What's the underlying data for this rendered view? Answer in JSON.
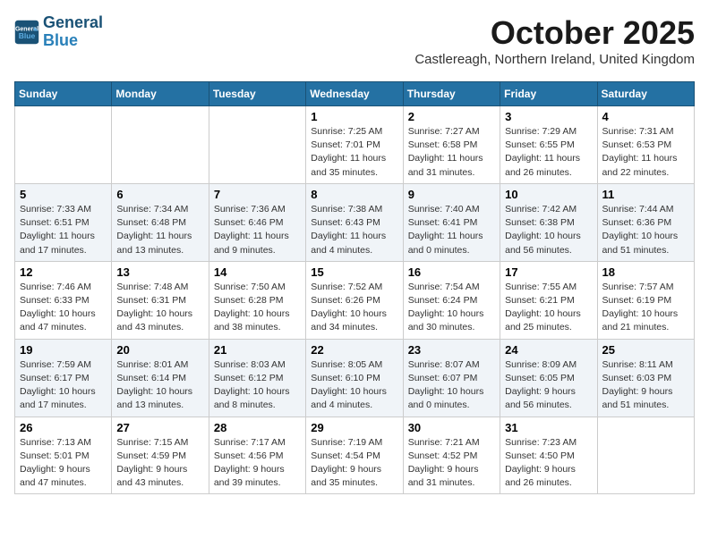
{
  "header": {
    "logo_line1": "General",
    "logo_line2": "Blue",
    "month_title": "October 2025",
    "subtitle": "Castlereagh, Northern Ireland, United Kingdom"
  },
  "days_of_week": [
    "Sunday",
    "Monday",
    "Tuesday",
    "Wednesday",
    "Thursday",
    "Friday",
    "Saturday"
  ],
  "weeks": [
    [
      {
        "day": "",
        "info": ""
      },
      {
        "day": "",
        "info": ""
      },
      {
        "day": "",
        "info": ""
      },
      {
        "day": "1",
        "info": "Sunrise: 7:25 AM\nSunset: 7:01 PM\nDaylight: 11 hours\nand 35 minutes."
      },
      {
        "day": "2",
        "info": "Sunrise: 7:27 AM\nSunset: 6:58 PM\nDaylight: 11 hours\nand 31 minutes."
      },
      {
        "day": "3",
        "info": "Sunrise: 7:29 AM\nSunset: 6:55 PM\nDaylight: 11 hours\nand 26 minutes."
      },
      {
        "day": "4",
        "info": "Sunrise: 7:31 AM\nSunset: 6:53 PM\nDaylight: 11 hours\nand 22 minutes."
      }
    ],
    [
      {
        "day": "5",
        "info": "Sunrise: 7:33 AM\nSunset: 6:51 PM\nDaylight: 11 hours\nand 17 minutes."
      },
      {
        "day": "6",
        "info": "Sunrise: 7:34 AM\nSunset: 6:48 PM\nDaylight: 11 hours\nand 13 minutes."
      },
      {
        "day": "7",
        "info": "Sunrise: 7:36 AM\nSunset: 6:46 PM\nDaylight: 11 hours\nand 9 minutes."
      },
      {
        "day": "8",
        "info": "Sunrise: 7:38 AM\nSunset: 6:43 PM\nDaylight: 11 hours\nand 4 minutes."
      },
      {
        "day": "9",
        "info": "Sunrise: 7:40 AM\nSunset: 6:41 PM\nDaylight: 11 hours\nand 0 minutes."
      },
      {
        "day": "10",
        "info": "Sunrise: 7:42 AM\nSunset: 6:38 PM\nDaylight: 10 hours\nand 56 minutes."
      },
      {
        "day": "11",
        "info": "Sunrise: 7:44 AM\nSunset: 6:36 PM\nDaylight: 10 hours\nand 51 minutes."
      }
    ],
    [
      {
        "day": "12",
        "info": "Sunrise: 7:46 AM\nSunset: 6:33 PM\nDaylight: 10 hours\nand 47 minutes."
      },
      {
        "day": "13",
        "info": "Sunrise: 7:48 AM\nSunset: 6:31 PM\nDaylight: 10 hours\nand 43 minutes."
      },
      {
        "day": "14",
        "info": "Sunrise: 7:50 AM\nSunset: 6:28 PM\nDaylight: 10 hours\nand 38 minutes."
      },
      {
        "day": "15",
        "info": "Sunrise: 7:52 AM\nSunset: 6:26 PM\nDaylight: 10 hours\nand 34 minutes."
      },
      {
        "day": "16",
        "info": "Sunrise: 7:54 AM\nSunset: 6:24 PM\nDaylight: 10 hours\nand 30 minutes."
      },
      {
        "day": "17",
        "info": "Sunrise: 7:55 AM\nSunset: 6:21 PM\nDaylight: 10 hours\nand 25 minutes."
      },
      {
        "day": "18",
        "info": "Sunrise: 7:57 AM\nSunset: 6:19 PM\nDaylight: 10 hours\nand 21 minutes."
      }
    ],
    [
      {
        "day": "19",
        "info": "Sunrise: 7:59 AM\nSunset: 6:17 PM\nDaylight: 10 hours\nand 17 minutes."
      },
      {
        "day": "20",
        "info": "Sunrise: 8:01 AM\nSunset: 6:14 PM\nDaylight: 10 hours\nand 13 minutes."
      },
      {
        "day": "21",
        "info": "Sunrise: 8:03 AM\nSunset: 6:12 PM\nDaylight: 10 hours\nand 8 minutes."
      },
      {
        "day": "22",
        "info": "Sunrise: 8:05 AM\nSunset: 6:10 PM\nDaylight: 10 hours\nand 4 minutes."
      },
      {
        "day": "23",
        "info": "Sunrise: 8:07 AM\nSunset: 6:07 PM\nDaylight: 10 hours\nand 0 minutes."
      },
      {
        "day": "24",
        "info": "Sunrise: 8:09 AM\nSunset: 6:05 PM\nDaylight: 9 hours\nand 56 minutes."
      },
      {
        "day": "25",
        "info": "Sunrise: 8:11 AM\nSunset: 6:03 PM\nDaylight: 9 hours\nand 51 minutes."
      }
    ],
    [
      {
        "day": "26",
        "info": "Sunrise: 7:13 AM\nSunset: 5:01 PM\nDaylight: 9 hours\nand 47 minutes."
      },
      {
        "day": "27",
        "info": "Sunrise: 7:15 AM\nSunset: 4:59 PM\nDaylight: 9 hours\nand 43 minutes."
      },
      {
        "day": "28",
        "info": "Sunrise: 7:17 AM\nSunset: 4:56 PM\nDaylight: 9 hours\nand 39 minutes."
      },
      {
        "day": "29",
        "info": "Sunrise: 7:19 AM\nSunset: 4:54 PM\nDaylight: 9 hours\nand 35 minutes."
      },
      {
        "day": "30",
        "info": "Sunrise: 7:21 AM\nSunset: 4:52 PM\nDaylight: 9 hours\nand 31 minutes."
      },
      {
        "day": "31",
        "info": "Sunrise: 7:23 AM\nSunset: 4:50 PM\nDaylight: 9 hours\nand 26 minutes."
      },
      {
        "day": "",
        "info": ""
      }
    ]
  ]
}
